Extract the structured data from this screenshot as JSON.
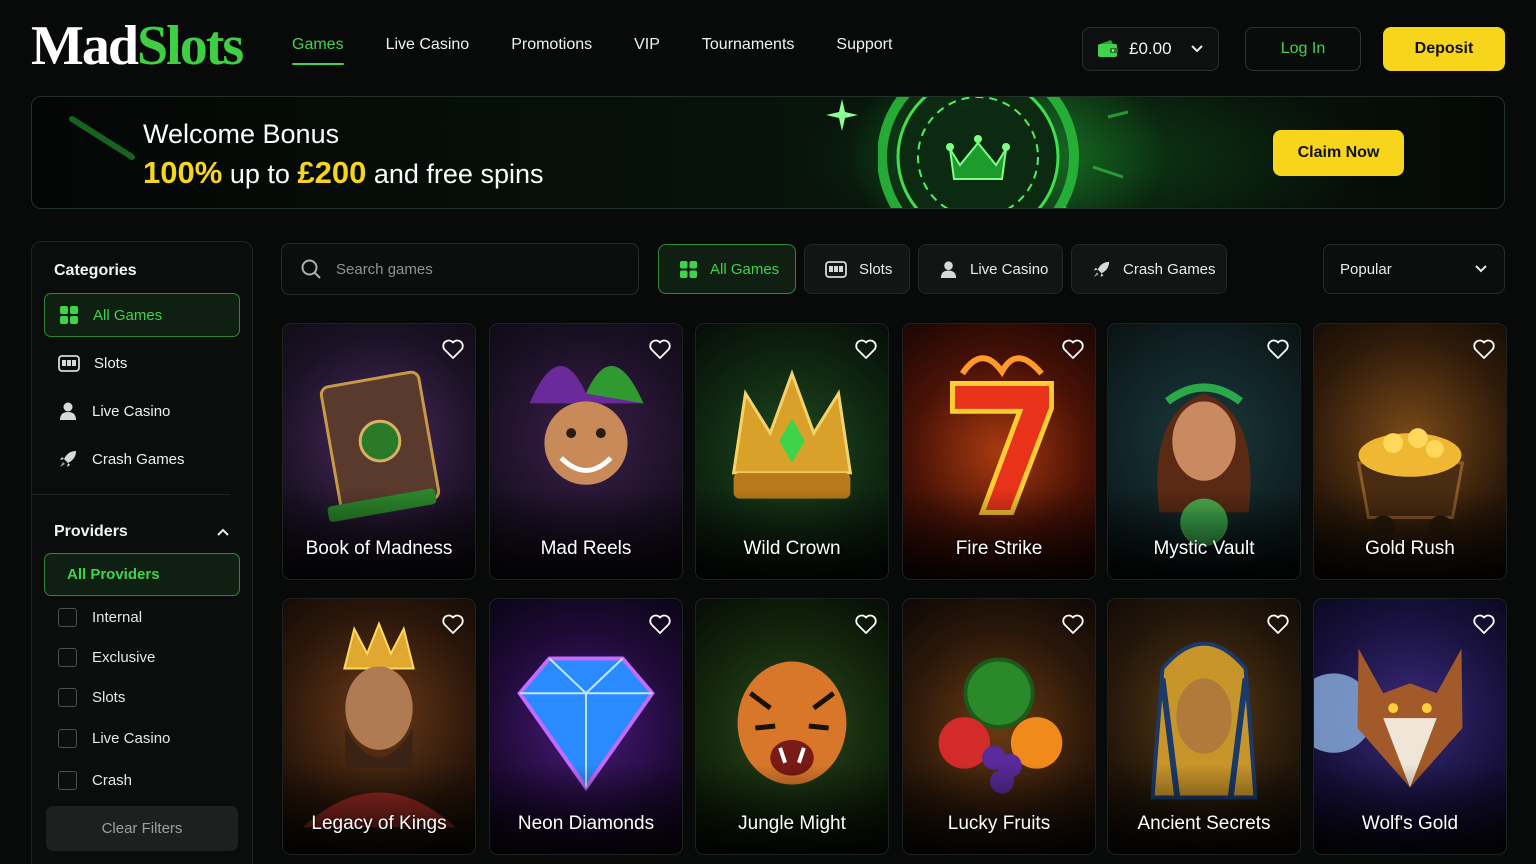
{
  "logo": {
    "part1": "Mad",
    "part2": "Slots"
  },
  "nav": [
    {
      "label": "Games"
    },
    {
      "label": "Live Casino"
    },
    {
      "label": "Promotions"
    },
    {
      "label": "VIP"
    },
    {
      "label": "Tournaments"
    },
    {
      "label": "Support"
    }
  ],
  "wallet": {
    "balance": "£0.00",
    "icon": "wallet-icon"
  },
  "header_buttons": {
    "login": "Log In",
    "deposit": "Deposit"
  },
  "banner": {
    "title": "Welcome Bonus",
    "percent": "100%",
    "up_to": "up to",
    "amount": "£200",
    "rest": "and free spins",
    "cta": "Claim Now"
  },
  "sidebar": {
    "categories_heading": "Categories",
    "categories": [
      {
        "label": "All Games",
        "icon": "grid-icon"
      },
      {
        "label": "Slots",
        "icon": "slot-machine-icon"
      },
      {
        "label": "Live Casino",
        "icon": "dealer-icon"
      },
      {
        "label": "Crash Games",
        "icon": "rocket-icon"
      }
    ],
    "providers_heading": "Providers",
    "providers_all": "All Providers",
    "providers": [
      {
        "label": "Internal"
      },
      {
        "label": "Exclusive"
      },
      {
        "label": "Slots"
      },
      {
        "label": "Live Casino"
      },
      {
        "label": "Crash"
      }
    ],
    "clear_filters": "Clear Filters"
  },
  "search": {
    "placeholder": "Search games"
  },
  "filters": [
    {
      "label": "All Games"
    },
    {
      "label": "Slots"
    },
    {
      "label": "Live Casino"
    },
    {
      "label": "Crash Games"
    }
  ],
  "sort": {
    "selected": "Popular"
  },
  "games": [
    {
      "title": "Book of Madness"
    },
    {
      "title": "Mad Reels"
    },
    {
      "title": "Wild Crown"
    },
    {
      "title": "Fire Strike"
    },
    {
      "title": "Mystic Vault"
    },
    {
      "title": "Gold Rush"
    },
    {
      "title": "Legacy of Kings"
    },
    {
      "title": "Neon Diamonds"
    },
    {
      "title": "Jungle Might"
    },
    {
      "title": "Lucky Fruits"
    },
    {
      "title": "Ancient Secrets"
    },
    {
      "title": "Wolf's Gold"
    }
  ],
  "colors": {
    "accent": "#3fd34a",
    "cta": "#f7d51b",
    "background": "#080a09"
  }
}
